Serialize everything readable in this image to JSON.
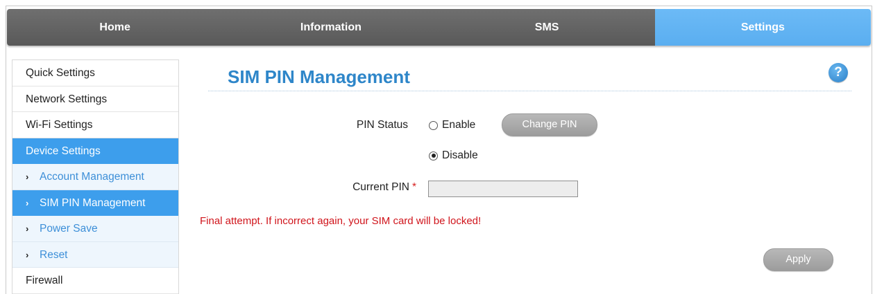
{
  "topnav": {
    "tabs": [
      {
        "label": "Home",
        "active": false
      },
      {
        "label": "Information",
        "active": false
      },
      {
        "label": "SMS",
        "active": false
      },
      {
        "label": "Settings",
        "active": true
      }
    ]
  },
  "sidebar": {
    "items": [
      {
        "label": "Quick Settings"
      },
      {
        "label": "Network Settings"
      },
      {
        "label": "Wi-Fi Settings"
      },
      {
        "label": "Device Settings",
        "active": true
      },
      {
        "label": "Account Management",
        "sub": true
      },
      {
        "label": "SIM PIN Management",
        "sub": true,
        "active": true
      },
      {
        "label": "Power Save",
        "sub": true
      },
      {
        "label": "Reset",
        "sub": true
      },
      {
        "label": "Firewall"
      }
    ],
    "sub_chevron": "›"
  },
  "main": {
    "title": "SIM PIN Management",
    "help_glyph": "?",
    "pin_status_label": "PIN Status",
    "enable_label": "Enable",
    "disable_label": "Disable",
    "selected": "Disable",
    "change_pin_label": "Change PIN",
    "current_pin_label": "Current PIN",
    "required_marker": "*",
    "current_pin_value": "",
    "warning": "Final attempt. If incorrect again, your SIM card will be locked!",
    "apply_label": "Apply"
  },
  "colors": {
    "accent": "#3d9eec",
    "settings_tab": "#5aaef0",
    "nav_dark": "#595959",
    "title": "#2e86c9",
    "warning": "#d0141b",
    "button_gray": "#a8a8a8"
  },
  "icons": {
    "help": "help-icon",
    "chevron": "chevron-right-icon"
  }
}
